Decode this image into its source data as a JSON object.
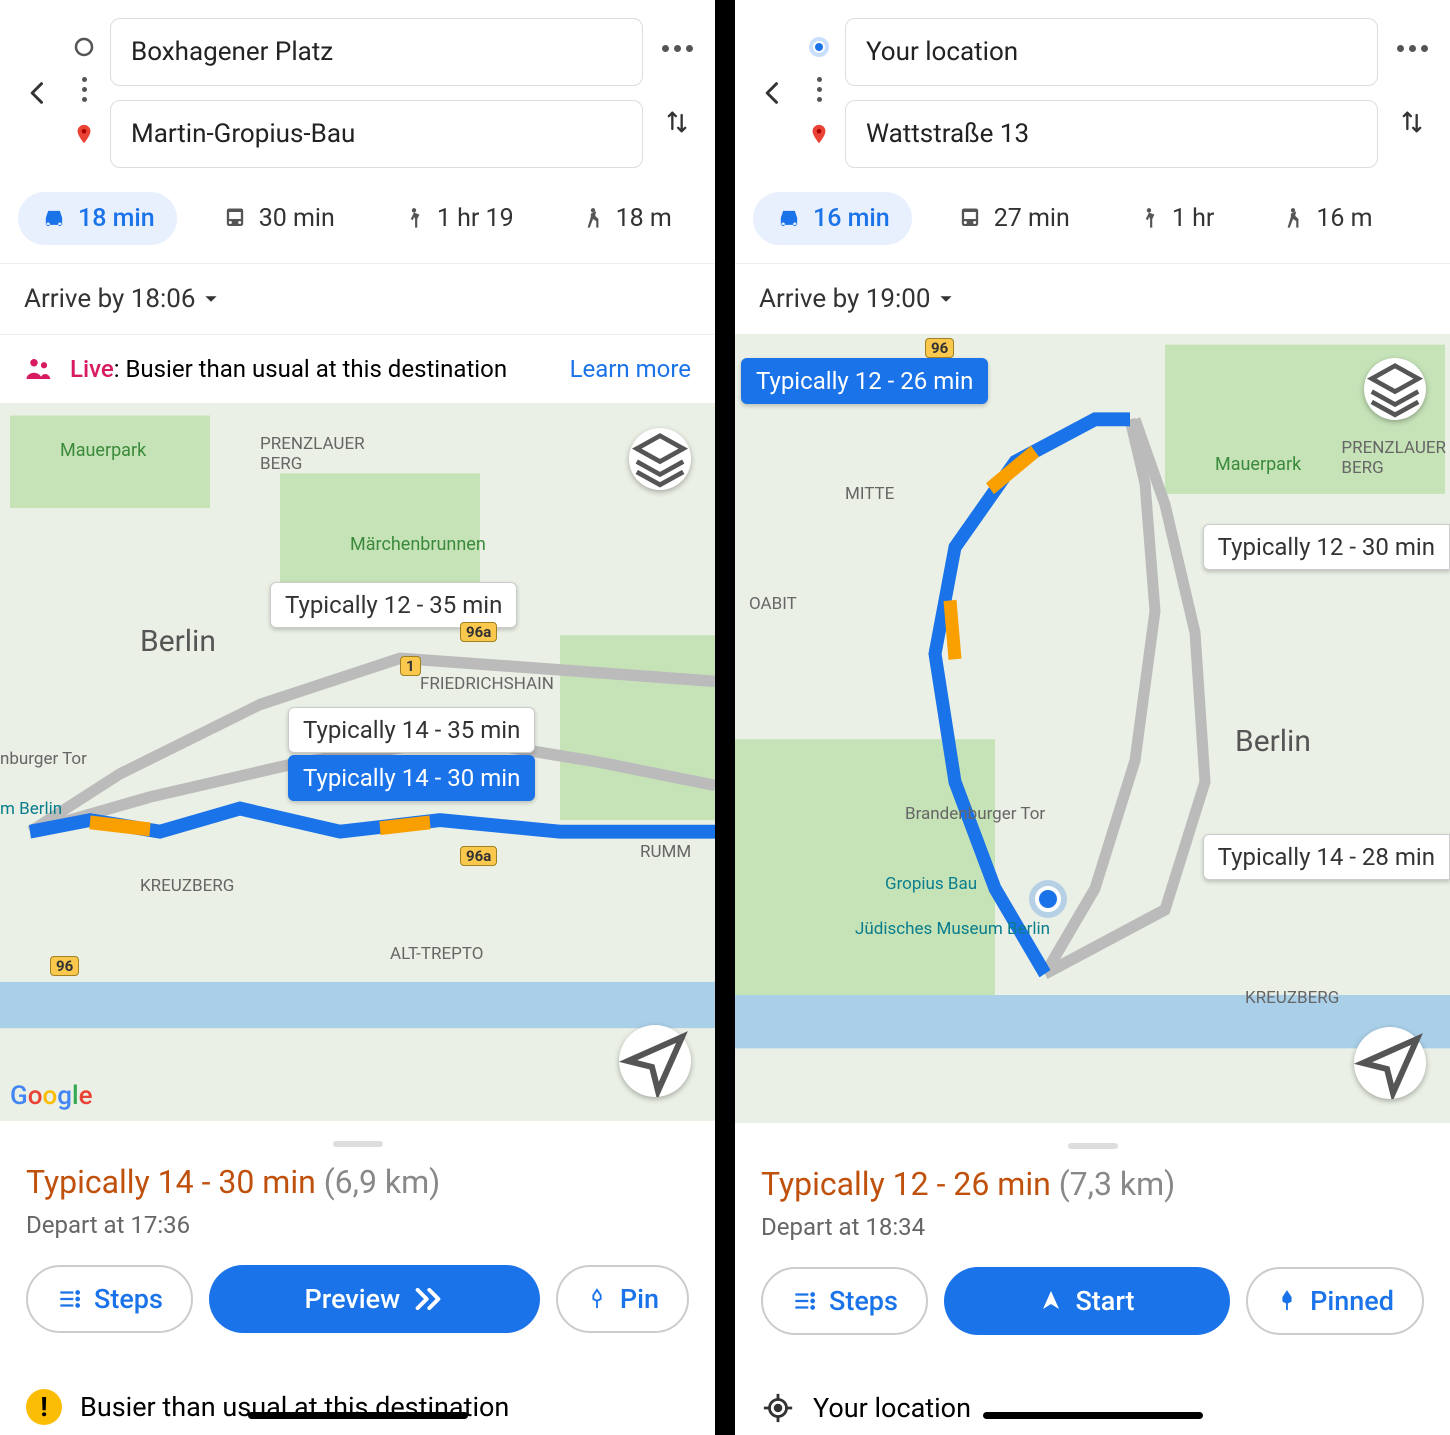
{
  "left": {
    "origin": "Boxhagener Platz",
    "destination": "Martin-Gropius-Bau",
    "modes": {
      "car": {
        "time": "18 min",
        "active": true
      },
      "transit": {
        "time": "30 min"
      },
      "walk": {
        "time": "1 hr 19"
      },
      "taxi": {
        "time": "18 m"
      }
    },
    "arrive_by": "Arrive by 18:06",
    "live_prefix": "Live",
    "live_text": ": Busier than usual at this destination",
    "learn_more": "Learn more",
    "map_labels": {
      "city": "Berlin",
      "mauerpark": "Mauerpark",
      "prenzlauer": "PRENZLAUER\nBERG",
      "marchen": "Märchenbrunnen",
      "friedrich": "FRIEDRICHSHAIN",
      "kreuzberg": "KREUZBERG",
      "alttrepto": "ALT-TREPTO",
      "rumm": "RUMM",
      "tor": "nburger Tor",
      "mberlin": "m Berlin"
    },
    "routes": [
      {
        "label": "Typically 12 - 35 min",
        "primary": false
      },
      {
        "label": "Typically 14 - 35 min",
        "primary": false
      },
      {
        "label": "Typically 14 - 30 min",
        "primary": true
      }
    ],
    "roads": [
      "96a",
      "1",
      "96a",
      "96"
    ],
    "summary_duration": "Typically 14 - 30 min",
    "summary_distance": "(6,9 km)",
    "depart": "Depart at 17:36",
    "btn_steps": "Steps",
    "btn_preview": "Preview",
    "btn_pin": "Pin",
    "bottom_warning": "Busier than usual at this destination"
  },
  "right": {
    "origin": "Your location",
    "destination": "Wattstraße 13",
    "modes": {
      "car": {
        "time": "16 min",
        "active": true
      },
      "transit": {
        "time": "27 min"
      },
      "walk": {
        "time": "1 hr"
      },
      "taxi": {
        "time": "16 m"
      }
    },
    "arrive_by": "Arrive by 19:00",
    "map_labels": {
      "city": "Berlin",
      "mauerpark": "Mauerpark",
      "prenzlauer": "PRENZLAUER\nBERG",
      "mitte": "MITTE",
      "oabit": "OABIT",
      "brandenburg": "Brandenburger Tor",
      "gropius": "Gropius Bau",
      "judisches": "Jüdisches Museum Berlin",
      "kreuzberg": "KREUZBERG"
    },
    "routes": [
      {
        "label": "Typically 12 - 26 min",
        "primary": true
      },
      {
        "label": "Typically 12 - 30 min",
        "primary": false
      },
      {
        "label": "Typically 14 - 28 min",
        "primary": false
      }
    ],
    "roads": [
      "96"
    ],
    "summary_duration": "Typically 12 - 26 min",
    "summary_distance": "(7,3 km)",
    "depart": "Depart at 18:34",
    "btn_steps": "Steps",
    "btn_start": "Start",
    "btn_pinned": "Pinned",
    "bottom_label": "Your location"
  }
}
